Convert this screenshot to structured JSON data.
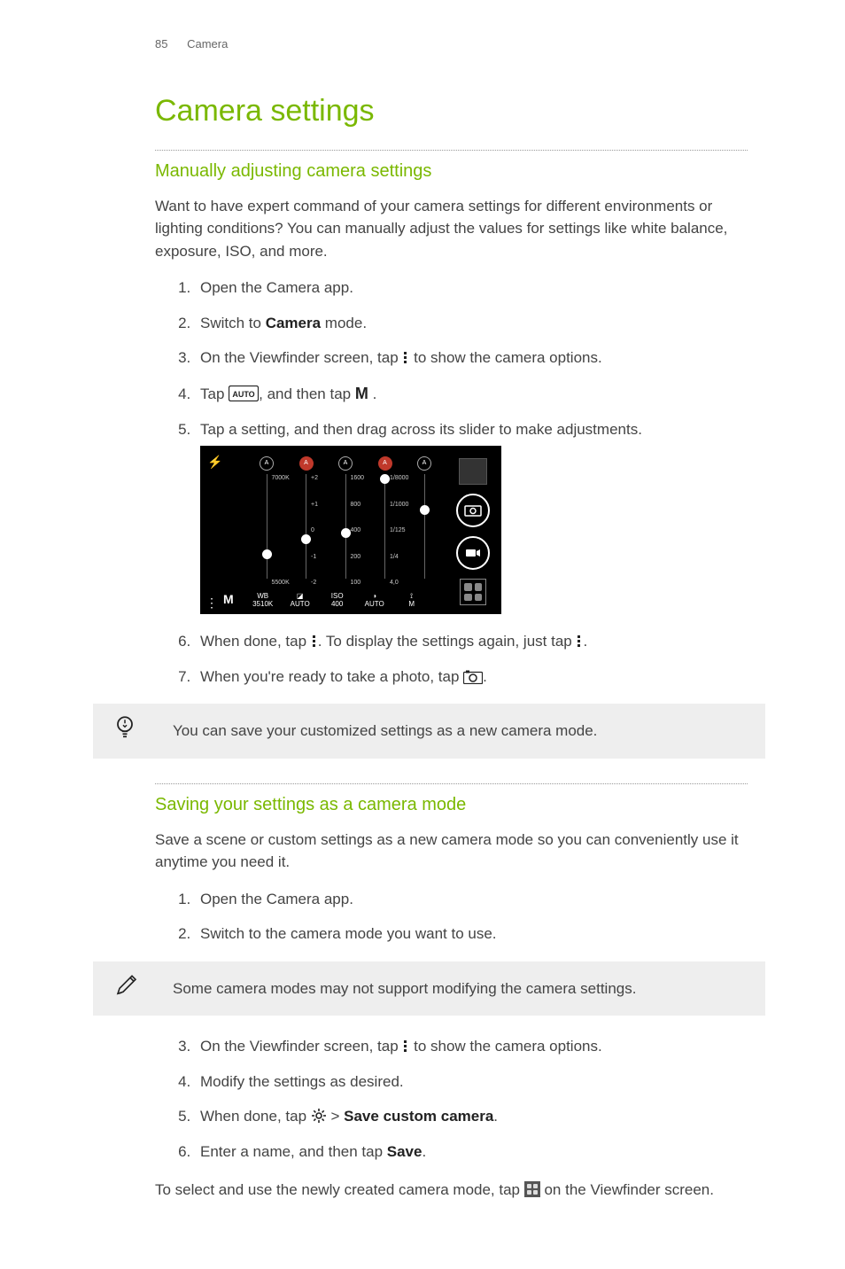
{
  "header": {
    "pageNum": "85",
    "section": "Camera"
  },
  "title": "Camera settings",
  "section1": {
    "heading": "Manually adjusting camera settings",
    "intro": "Want to have expert command of your camera settings for different environments or lighting conditions? You can manually adjust the values for settings like white balance, exposure, ISO, and more.",
    "steps": {
      "s1": "Open the Camera app.",
      "s2a": "Switch to ",
      "s2b": "Camera",
      "s2c": " mode.",
      "s3a": "On the Viewfinder screen, tap ",
      "s3b": " to show the camera options.",
      "s4a": "Tap ",
      "s4b": ", and then tap ",
      "s4c": "M",
      "s4d": " .",
      "s5": "Tap a setting, and then drag across its slider to make adjustments.",
      "s6a": "When done, tap ",
      "s6b": ". To display the settings again, just tap ",
      "s6c": ".",
      "s7a": "When you're ready to take a photo, tap ",
      "s7b": "."
    },
    "tip": "You can save your customized settings as a new camera mode."
  },
  "section2": {
    "heading": "Saving your settings as a camera mode",
    "intro": "Save a scene or custom settings as a new camera mode so you can conveniently use it anytime you need it.",
    "steps1": {
      "s1": "Open the Camera app.",
      "s2": "Switch to the camera mode you want to use."
    },
    "note": "Some camera modes may not support modifying the camera settings.",
    "steps2": {
      "s3a": "On the Viewfinder screen, tap ",
      "s3b": " to show the camera options.",
      "s4": "Modify the settings as desired.",
      "s5a": "When done, tap ",
      "s5b": " > ",
      "s5c": "Save custom camera",
      "s5d": ".",
      "s6a": "Enter a name, and then tap ",
      "s6b": "Save",
      "s6c": "."
    },
    "outro1": "To select and use the newly created camera mode, tap ",
    "outro2": " on the Viewfinder screen."
  },
  "viewfinder": {
    "mode": "M",
    "autoBadge": "AUTO",
    "sliders": [
      {
        "head": "A",
        "headRed": false,
        "labels": [
          "7000K",
          "5500K"
        ],
        "knobTop": 72,
        "footTop": "WB",
        "footBot": "3510K"
      },
      {
        "head": "A",
        "headRed": true,
        "labels": [
          "+2",
          "+1",
          "0",
          "-1",
          "-2"
        ],
        "knobTop": 58,
        "footTop": "",
        "footBot": "AUTO",
        "footIcon": "ev"
      },
      {
        "head": "A",
        "headRed": false,
        "labels": [
          "1600",
          "800",
          "400",
          "200",
          "100"
        ],
        "knobTop": 52,
        "footTop": "ISO",
        "footBot": "400"
      },
      {
        "head": "A",
        "headRed": true,
        "labels": [
          "1/8000",
          "1/1000",
          "1/125",
          "1/4",
          "4,0"
        ],
        "knobTop": 0,
        "footTop": "",
        "footBot": "AUTO",
        "footIcon": "shutter"
      },
      {
        "head": "A",
        "headRed": false,
        "labels": [
          "",
          "",
          "",
          ""
        ],
        "knobTop": 30,
        "footTop": "",
        "footBot": "M",
        "footIcon": "focus"
      }
    ]
  }
}
